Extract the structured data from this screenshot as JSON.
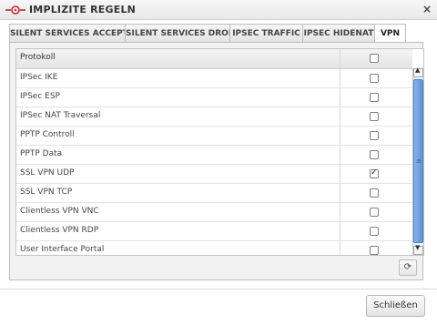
{
  "window": {
    "title": "IMPLIZITE REGELN",
    "close_glyph": "×"
  },
  "tabs": [
    {
      "label": "SILENT SERVICES ACCEPT",
      "active": false
    },
    {
      "label": "SILENT SERVICES DROP",
      "active": false
    },
    {
      "label": "IPSEC TRAFFIC",
      "active": false
    },
    {
      "label": "IPSEC HIDENAT",
      "active": false
    },
    {
      "label": "VPN",
      "active": true
    }
  ],
  "table": {
    "header": {
      "label": "Protokoll",
      "checked": false
    },
    "rows": [
      {
        "label": "IPSec IKE",
        "checked": false
      },
      {
        "label": "IPSec ESP",
        "checked": false
      },
      {
        "label": "IPSec NAT Traversal",
        "checked": false
      },
      {
        "label": "PPTP Controll",
        "checked": false
      },
      {
        "label": "PPTP Data",
        "checked": false
      },
      {
        "label": "SSL VPN UDP",
        "checked": true
      },
      {
        "label": "SSL VPN TCP",
        "checked": false
      },
      {
        "label": "Clientless VPN VNC",
        "checked": false
      },
      {
        "label": "Clientless VPN RDP",
        "checked": false
      },
      {
        "label": "User Interface Portal",
        "checked": false
      }
    ]
  },
  "icons": {
    "logo": "ring-arrows-logo",
    "refresh": "refresh-icon",
    "scroll_up": "chevron-up-icon",
    "scroll_down": "chevron-down-icon"
  },
  "refresh_glyph": "⟳",
  "scroll_up_glyph": "▲",
  "scroll_down_glyph": "▼",
  "grip_glyph": "≡",
  "check_glyph": "✓",
  "footer": {
    "close_label": "Schließen"
  },
  "colors": {
    "accent": "#c0272d",
    "scroll_thumb": "#5e93d6"
  }
}
